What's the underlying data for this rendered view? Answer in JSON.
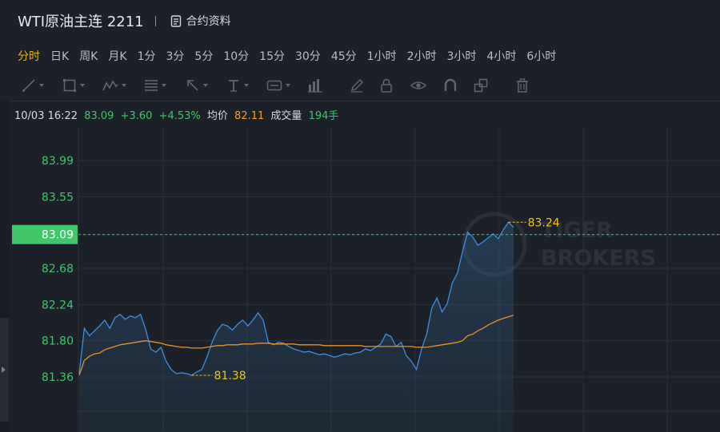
{
  "header": {
    "title": "WTI原油主连 2211",
    "info_label": "合约资料"
  },
  "periods": [
    "分时",
    "日K",
    "周K",
    "月K",
    "1分",
    "3分",
    "5分",
    "10分",
    "15分",
    "30分",
    "45分",
    "1小时",
    "2小时",
    "3小时",
    "4小时",
    "6小时"
  ],
  "active_period": "分时",
  "tools": [
    "line-tool-icon",
    "rect-tool-icon",
    "wave-tool-icon",
    "fib-tool-icon",
    "arrow-tool-icon",
    "text-tool-icon",
    "label-tool-icon",
    "volume-tool-icon",
    "pen-icon",
    "lock-icon",
    "eye-icon",
    "magnet-icon",
    "clone-icon",
    "trash-icon"
  ],
  "quote": {
    "time": "10/03 16:22",
    "price": "83.09",
    "change": "+3.60",
    "change_pct": "+4.53%",
    "avg_label": "均价",
    "avg_value": "82.11",
    "volume_label": "成交量",
    "volume_value": "194手"
  },
  "watermark": [
    "TIGER",
    "BROKERS"
  ],
  "colors": {
    "price_line": "#3d8fe0",
    "avg_line": "#e8922a",
    "up": "#3fc76a",
    "highlight": "#f0c419",
    "active": "#f0b400"
  },
  "chart_data": {
    "type": "line",
    "y_ticks": [
      "83.99",
      "83.55",
      "83.09",
      "82.68",
      "82.24",
      "81.80",
      "81.36"
    ],
    "ylim": [
      81.1,
      84.3
    ],
    "current_price": 83.09,
    "current_label": "83.09",
    "high": 83.24,
    "high_label": "83.24",
    "low": 81.38,
    "low_label": "81.38",
    "series": [
      {
        "values": [
          81.4,
          81.95,
          81.86,
          81.92,
          81.98,
          82.05,
          81.95,
          82.08,
          82.12,
          82.06,
          82.1,
          82.08,
          82.12,
          81.94,
          81.7,
          81.66,
          81.72,
          81.55,
          81.45,
          81.4,
          81.41,
          81.4,
          81.38,
          81.42,
          81.45,
          81.6,
          81.78,
          81.92,
          82.0,
          81.98,
          81.93,
          82.0,
          82.05,
          81.98,
          82.05,
          82.14,
          82.05,
          81.78,
          81.75,
          81.78,
          81.77,
          81.73,
          81.7,
          81.68,
          81.66,
          81.67,
          81.65,
          81.63,
          81.64,
          81.62,
          81.6,
          81.62,
          81.64,
          81.63,
          81.65,
          81.66,
          81.7,
          81.68,
          81.72,
          81.76,
          81.88,
          81.85,
          81.73,
          81.78,
          81.62,
          81.55,
          81.45,
          81.7,
          81.88,
          82.2,
          82.32,
          82.15,
          82.25,
          82.5,
          82.62,
          82.88,
          83.12,
          83.06,
          82.96,
          83.0,
          83.05,
          83.1,
          83.04,
          83.15,
          83.24,
          83.18
        ]
      },
      {
        "values": [
          81.38,
          81.56,
          81.61,
          81.64,
          81.65,
          81.69,
          81.71,
          81.73,
          81.75,
          81.76,
          81.77,
          81.78,
          81.79,
          81.8,
          81.79,
          81.78,
          81.77,
          81.75,
          81.74,
          81.73,
          81.72,
          81.72,
          81.71,
          81.71,
          81.71,
          81.72,
          81.73,
          81.74,
          81.74,
          81.75,
          81.75,
          81.75,
          81.76,
          81.76,
          81.76,
          81.77,
          81.77,
          81.77,
          81.76,
          81.76,
          81.76,
          81.76,
          81.76,
          81.75,
          81.75,
          81.75,
          81.75,
          81.75,
          81.74,
          81.74,
          81.74,
          81.74,
          81.74,
          81.74,
          81.74,
          81.74,
          81.73,
          81.73,
          81.73,
          81.73,
          81.73,
          81.73,
          81.73,
          81.73,
          81.73,
          81.73,
          81.72,
          81.72,
          81.72,
          81.73,
          81.74,
          81.75,
          81.76,
          81.77,
          81.78,
          81.8,
          81.86,
          81.88,
          81.92,
          81.95,
          81.99,
          82.02,
          82.05,
          82.07,
          82.09,
          82.11
        ]
      }
    ]
  }
}
